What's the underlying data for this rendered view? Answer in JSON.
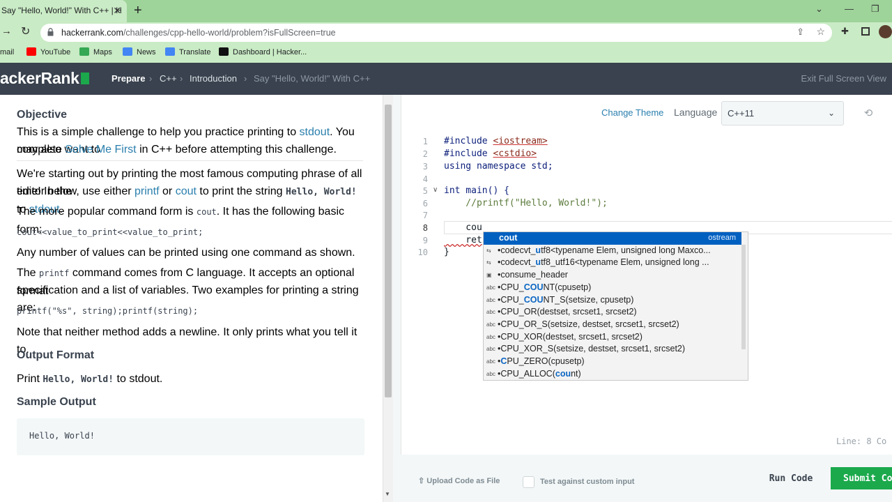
{
  "browser": {
    "tab_title": "Say \"Hello, World!\" With C++ | H",
    "tab_close": "✕",
    "new_tab": "+",
    "url_host": "hackerrank.com",
    "url_path": "/challenges/cpp-hello-world/problem?isFullScreen=true",
    "bookmarks": [
      {
        "label": "mail",
        "color": "#d93025"
      },
      {
        "label": "YouTube",
        "color": "#ff0000"
      },
      {
        "label": "Maps",
        "color": "#34a853"
      },
      {
        "label": "News",
        "color": "#4285f4"
      },
      {
        "label": "Translate",
        "color": "#4285f4"
      },
      {
        "label": "Dashboard | Hacker...",
        "color": "#111111"
      }
    ]
  },
  "header": {
    "logo": "ackerRank",
    "prepare": "Prepare",
    "sep": "›",
    "crumb_cpp": "C++",
    "crumb_intro": "Introduction",
    "crumb_challenge": "Say \"Hello, World!\" With C++",
    "exit_fullscreen": "Exit Full Screen View"
  },
  "problem": {
    "objective_title": "Objective",
    "obj_l1": "This is a simple challenge to help you practice printing to ",
    "obj_l1_link": "stdout",
    "obj_l1_tail": ". You may also want to",
    "obj_l2_pre": "complete ",
    "obj_l2_link": "Solve Me First",
    "obj_l2_tail": " in C++ before attempting this challenge.",
    "p1_l1": "We're starting out by printing the most famous computing phrase of all time! In the",
    "p1_l2_a": "editor below, use either ",
    "p1_l2_printf": "printf",
    "p1_l2_or": " or ",
    "p1_l2_cout": "cout",
    "p1_l2_b": " to print the string ",
    "p1_l2_hello": "Hello, World!",
    "p1_l2_to": " to ",
    "p1_l2_stdout": "stdout",
    "p1_l2_end": ".",
    "p2_a": "The more popular command form is ",
    "p2_cout": "cout",
    "p2_b": ". It has the following basic form:",
    "code1": "cout<<value_to_print<<value_to_print;",
    "p3": "Any number of values can be printed using one command as shown.",
    "p4_a": "The ",
    "p4_printf": "printf",
    "p4_b": " command comes from C language. It accepts an optional format",
    "p4_l2": "specification and a list of variables. Two examples for printing a string are:",
    "code2": "printf(\"%s\", string);printf(string);",
    "p5": "Note that neither method adds a newline. It only prints what you tell it to.",
    "output_title": "Output Format",
    "out_a": "Print ",
    "out_hello": "Hello, World!",
    "out_b": " to stdout.",
    "sample_title": "Sample Output",
    "sample": "Hello, World!"
  },
  "editor": {
    "change_theme": "Change Theme",
    "language_label": "Language",
    "language_value": "C++11",
    "line_numbers": [
      "1",
      "2",
      "3",
      "4",
      "5",
      "6",
      "7",
      "8",
      "9",
      "10"
    ],
    "l1_kw": "#include ",
    "l1_inc": "<iostream>",
    "l2_kw": "#include ",
    "l2_inc": "<cstdio>",
    "l3": "using namespace std;",
    "l5": "int main() {",
    "l6": "    //printf(\"Hello, World!\");",
    "l8": "    cou",
    "l9": "    ret",
    "l10": "}",
    "status": "Line: 8 Co"
  },
  "autocomplete": {
    "selected": "cout",
    "selected_detail": "ostream",
    "items": [
      {
        "icon": "⇆",
        "pre": "•codecvt_",
        "hl": "u",
        "post": "tf8<typename Elem, unsigned long Maxco..."
      },
      {
        "icon": "⇆",
        "pre": "•codecvt_",
        "hl": "u",
        "post": "tf8_utf16<typename Elem, unsigned long ..."
      },
      {
        "icon": "▣",
        "pre": "•consume_header",
        "hl": "",
        "post": ""
      },
      {
        "icon": "abc",
        "pre": "•CPU_",
        "hl": "COU",
        "post": "NT(cpusetp)"
      },
      {
        "icon": "abc",
        "pre": "•CPU_",
        "hl": "COU",
        "post": "NT_S(setsize, cpusetp)"
      },
      {
        "icon": "abc",
        "pre": "•CPU_OR(destset, srcset1, srcset2)",
        "hl": "",
        "post": ""
      },
      {
        "icon": "abc",
        "pre": "•CPU_OR_S(setsize, destset, srcset1, srcset2)",
        "hl": "",
        "post": ""
      },
      {
        "icon": "abc",
        "pre": "•CPU_XOR(destset, srcset1, srcset2)",
        "hl": "",
        "post": ""
      },
      {
        "icon": "abc",
        "pre": "•CPU_XOR_S(setsize, destset, srcset1, srcset2)",
        "hl": "",
        "post": ""
      },
      {
        "icon": "abc",
        "pre": "•",
        "hl": "C",
        "post": "PU_ZERO(cpusetp)"
      },
      {
        "icon": "abc",
        "pre": "•CPU_ALLOC(",
        "hl": "cou",
        "post": "nt)"
      }
    ]
  },
  "actions": {
    "upload": "Upload Code as File",
    "custom_input": "Test against custom input",
    "run": "Run Code",
    "submit": "Submit Code"
  }
}
